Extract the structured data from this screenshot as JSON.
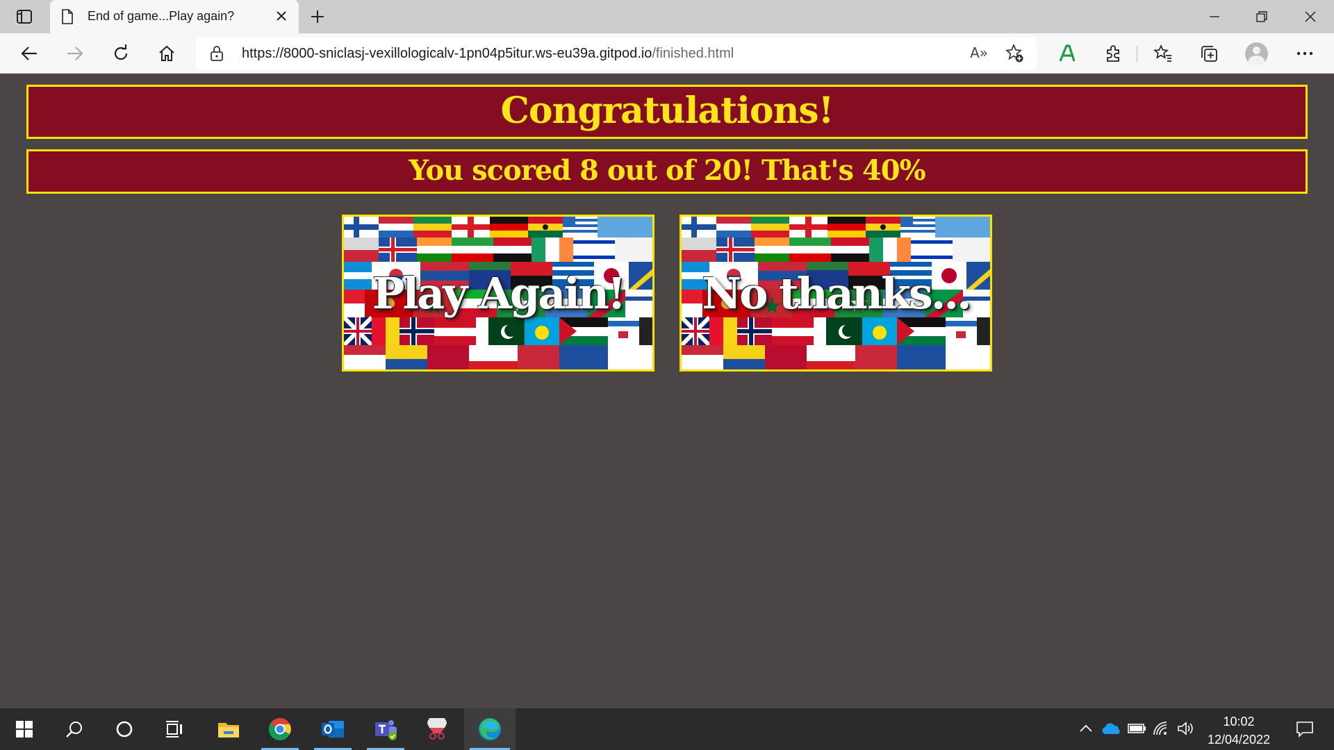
{
  "browser": {
    "tab_title": "End of game...Play again?",
    "url_host": "https://8000-sniclasj-vexillologicalv-1pn04p5itur.ws-eu39a.gitpod.io",
    "url_path": "/finished.html",
    "read_aloud": "A»"
  },
  "page": {
    "heading": "Congratulations!",
    "score_text": "You scored 8 out of 20! That's 40%",
    "buttons": {
      "play_again": "Play Again!",
      "no_thanks": "No thanks..."
    }
  },
  "taskbar": {
    "time": "10:02",
    "date": "12/04/2022",
    "apps": [
      "start",
      "search",
      "cortana",
      "task-view",
      "file-explorer",
      "chrome",
      "outlook",
      "teams",
      "snip-sketch",
      "edge"
    ]
  },
  "colors": {
    "banner_bg": "#840d21",
    "banner_border": "#f7e200",
    "banner_text": "#fbe51a",
    "page_bg": "#4b4545"
  }
}
